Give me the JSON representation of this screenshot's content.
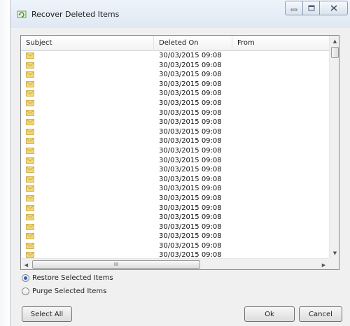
{
  "window": {
    "title": "Recover Deleted Items"
  },
  "list": {
    "columns": {
      "subject": "Subject",
      "deleted_on": "Deleted On",
      "from": "From"
    },
    "rows": [
      {
        "deleted_on": "30/03/2015 09:08"
      },
      {
        "deleted_on": "30/03/2015 09:08"
      },
      {
        "deleted_on": "30/03/2015 09:08"
      },
      {
        "deleted_on": "30/03/2015 09:08"
      },
      {
        "deleted_on": "30/03/2015 09:08"
      },
      {
        "deleted_on": "30/03/2015 09:08"
      },
      {
        "deleted_on": "30/03/2015 09:08"
      },
      {
        "deleted_on": "30/03/2015 09:08"
      },
      {
        "deleted_on": "30/03/2015 09:08"
      },
      {
        "deleted_on": "30/03/2015 09:08"
      },
      {
        "deleted_on": "30/03/2015 09:08"
      },
      {
        "deleted_on": "30/03/2015 09:08"
      },
      {
        "deleted_on": "30/03/2015 09:08"
      },
      {
        "deleted_on": "30/03/2015 09:08"
      },
      {
        "deleted_on": "30/03/2015 09:08"
      },
      {
        "deleted_on": "30/03/2015 09:08"
      },
      {
        "deleted_on": "30/03/2015 09:08"
      },
      {
        "deleted_on": "30/03/2015 09:08"
      },
      {
        "deleted_on": "30/03/2015 09:08"
      },
      {
        "deleted_on": "30/03/2015 09:08"
      },
      {
        "deleted_on": "30/03/2015 09:08"
      },
      {
        "deleted_on": "30/03/2015 09:08"
      }
    ],
    "row_icon": "envelope-icon",
    "hscroll_grip": "III"
  },
  "options": {
    "restore_label": "Restore Selected Items",
    "purge_label": "Purge Selected Items",
    "selected": "restore"
  },
  "buttons": {
    "select_all": "Select All",
    "ok": "Ok",
    "cancel": "Cancel"
  },
  "colors": {
    "envelope_fill": "#f2d777",
    "envelope_stroke": "#c9a63c",
    "radio_dot": "#2a62c6"
  }
}
